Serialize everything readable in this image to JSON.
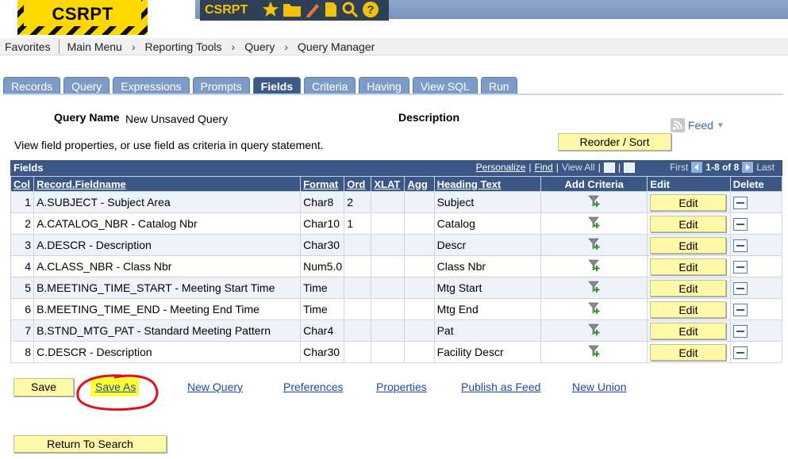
{
  "header": {
    "logo_text": "CSRPT",
    "app_title": "CSRPT",
    "icons": [
      "star-icon",
      "folder-icon",
      "pencil-icon",
      "document-icon",
      "search-icon",
      "help-icon"
    ]
  },
  "breadcrumb": [
    "Favorites",
    "Main Menu",
    "Reporting Tools",
    "Query",
    "Query Manager"
  ],
  "tabs": [
    "Records",
    "Query",
    "Expressions",
    "Prompts",
    "Fields",
    "Criteria",
    "Having",
    "View SQL",
    "Run"
  ],
  "active_tab": "Fields",
  "query": {
    "name_label": "Query Name",
    "name_value": "New Unsaved Query",
    "description_label": "Description",
    "feed_label": "Feed",
    "instructions": "View field properties, or use field as criteria in query statement.",
    "reorder_button": "Reorder / Sort"
  },
  "grid": {
    "title": "Fields",
    "personalize": "Personalize",
    "find": "Find",
    "view_all": "View All",
    "first": "First",
    "range": "1-8 of 8",
    "last": "Last",
    "columns": [
      "Col",
      "Record.Fieldname",
      "Format",
      "Ord",
      "XLAT",
      "Agg",
      "Heading Text",
      "Add Criteria",
      "Edit",
      "Delete"
    ],
    "edit_label": "Edit",
    "rows": [
      {
        "col": "1",
        "field": "A.SUBJECT - Subject Area",
        "format": "Char8",
        "ord": "2",
        "xlat": "",
        "agg": "",
        "heading": "Subject"
      },
      {
        "col": "2",
        "field": "A.CATALOG_NBR - Catalog Nbr",
        "format": "Char10",
        "ord": "1",
        "xlat": "",
        "agg": "",
        "heading": "Catalog"
      },
      {
        "col": "3",
        "field": "A.DESCR - Description",
        "format": "Char30",
        "ord": "",
        "xlat": "",
        "agg": "",
        "heading": "Descr"
      },
      {
        "col": "4",
        "field": "A.CLASS_NBR - Class Nbr",
        "format": "Num5.0",
        "ord": "",
        "xlat": "",
        "agg": "",
        "heading": "Class Nbr"
      },
      {
        "col": "5",
        "field": "B.MEETING_TIME_START - Meeting Start Time",
        "format": "Time",
        "ord": "",
        "xlat": "",
        "agg": "",
        "heading": "Mtg Start"
      },
      {
        "col": "6",
        "field": "B.MEETING_TIME_END - Meeting End Time",
        "format": "Time",
        "ord": "",
        "xlat": "",
        "agg": "",
        "heading": "Mtg End"
      },
      {
        "col": "7",
        "field": "B.STND_MTG_PAT - Standard Meeting Pattern",
        "format": "Char4",
        "ord": "",
        "xlat": "",
        "agg": "",
        "heading": "Pat"
      },
      {
        "col": "8",
        "field": "C.DESCR - Description",
        "format": "Char30",
        "ord": "",
        "xlat": "",
        "agg": "",
        "heading": "Facility Descr"
      }
    ]
  },
  "actions": {
    "save": "Save",
    "save_as": "Save As",
    "new_query": "New Query",
    "preferences": "Preferences",
    "properties": "Properties",
    "publish_feed": "Publish as Feed",
    "new_union": "New Union",
    "return_to_search": "Return To Search"
  },
  "colors": {
    "tab": "#7c9cc7",
    "tab_active": "#3d5b86",
    "grid_header": "#3b5785",
    "button": "#fff8a8",
    "link": "#1c48a8",
    "annotation_circle": "#e3101a",
    "highlight": "#ffff33"
  }
}
